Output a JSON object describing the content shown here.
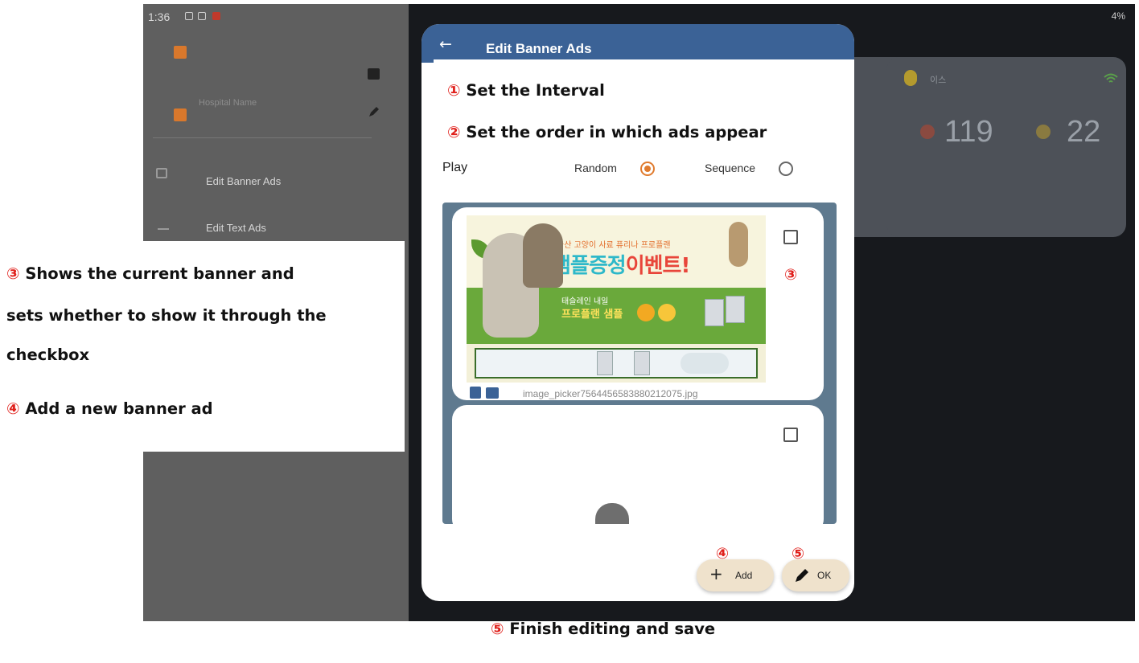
{
  "status_bar": {
    "time": "1:36",
    "right_text": "4%"
  },
  "settings_panel": {
    "hospital_name_label": "Hospital Name",
    "menu_items": [
      {
        "label": "Edit Banner Ads",
        "icon": "banner-icon"
      },
      {
        "label": "Edit Text Ads",
        "icon": "text-lines-icon"
      }
    ]
  },
  "dashboard": {
    "card_label": "이스",
    "values": [
      "119",
      "22"
    ]
  },
  "dialog": {
    "title": "Edit Banner Ads",
    "back_icon": "back-arrow-icon",
    "play": {
      "label": "Play",
      "options": [
        {
          "label": "Random",
          "selected": true
        },
        {
          "label": "Sequence",
          "selected": false
        }
      ]
    },
    "banners": [
      {
        "file_name": "image_picker7564456583880212075.jpg",
        "checked": false,
        "promo": {
          "line1": "국산 고양이 사료 퓨리나 프로플랜",
          "headline_part1": "샘플증정",
          "headline_part2": "이벤트!",
          "mid_line1": "태슬레인 내일",
          "mid_line2": "프로플랜 샘플"
        }
      },
      {
        "file_name": "",
        "checked": false
      }
    ],
    "add_button": {
      "label": "Add",
      "icon": "plus-icon"
    },
    "ok_button": {
      "label": "OK",
      "icon": "pencil-icon"
    }
  },
  "annotations": {
    "n1": "①",
    "t1": "Set the Interval",
    "n2": "②",
    "t2": "Set the order in which ads appear",
    "n3": "③",
    "t3a": "Shows the current banner and",
    "t3b": "sets whether to show it through the",
    "t3c": "checkbox",
    "n4": "④",
    "t4": "Add a new banner ad",
    "n5": "⑤",
    "t5": "Finish editing and save",
    "marker3": "③",
    "marker4": "④",
    "marker5": "⑤"
  },
  "colors": {
    "header_blue": "#3b6296",
    "accent_orange": "#e07b2e",
    "list_bg": "#5f7a8f",
    "fab_bg": "#efe2cc",
    "annotation_red": "#e0201b"
  }
}
